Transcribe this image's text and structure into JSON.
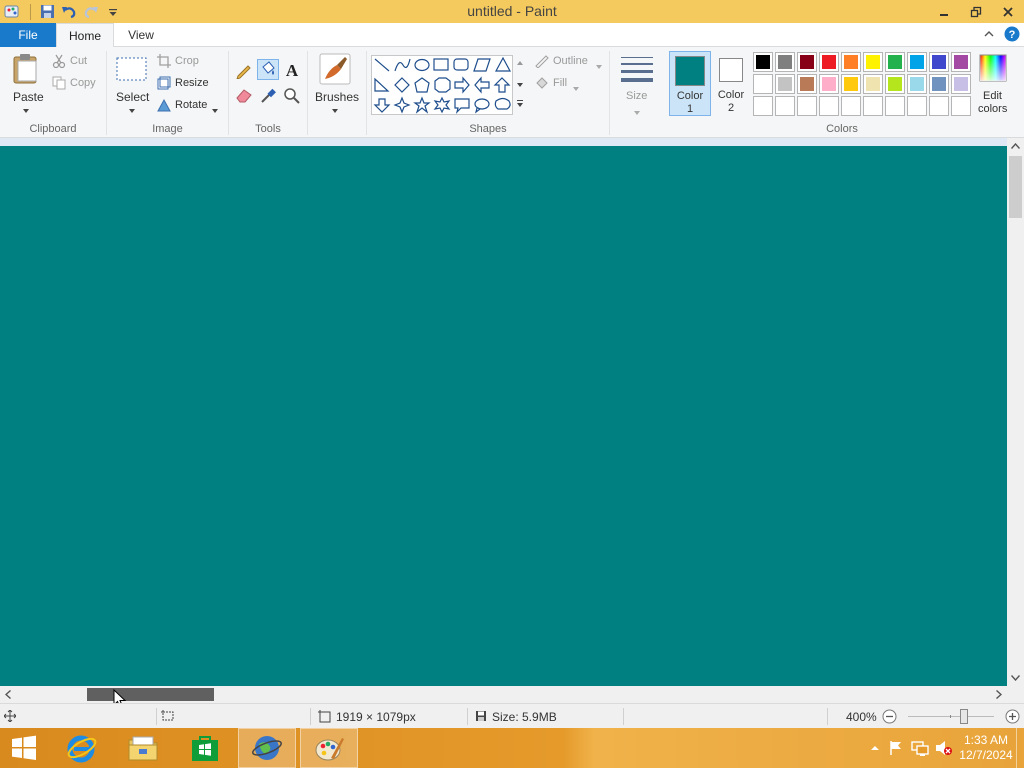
{
  "window": {
    "title": "untitled - Paint"
  },
  "tabs": {
    "file": "File",
    "home": "Home",
    "view": "View"
  },
  "ribbon": {
    "clipboard": {
      "paste": "Paste",
      "cut": "Cut",
      "copy": "Copy",
      "label": "Clipboard"
    },
    "image": {
      "select": "Select",
      "crop": "Crop",
      "resize": "Resize",
      "rotate": "Rotate",
      "label": "Image"
    },
    "tools": {
      "label": "Tools"
    },
    "brushes": {
      "label": "Brushes"
    },
    "shapes": {
      "outline": "Outline",
      "fill": "Fill",
      "label": "Shapes"
    },
    "size": {
      "label": "Size"
    },
    "colors": {
      "color1_label": "Color",
      "color1_num": "1",
      "color2_label": "Color",
      "color2_num": "2",
      "edit1": "Edit",
      "edit2": "colors",
      "label": "Colors",
      "color1": "#008080",
      "color2": "#ffffff",
      "palette_row1": [
        "#000000",
        "#7f7f7f",
        "#880015",
        "#ed1c24",
        "#ff7f27",
        "#fff200",
        "#22b14c",
        "#00a2e8",
        "#3f48cc",
        "#a349a4"
      ],
      "palette_row2": [
        "#ffffff",
        "#c3c3c3",
        "#b97a57",
        "#ffaec9",
        "#ffc90e",
        "#efe4b0",
        "#b5e61d",
        "#99d9ea",
        "#7092be",
        "#c8bfe7"
      ]
    }
  },
  "canvas": {
    "color": "#008080"
  },
  "status": {
    "dimensions": "1919 × 1079px",
    "size": "Size: 5.9MB",
    "zoom": "400%"
  },
  "taskbar": {
    "time": "1:33 AM",
    "date": "12/7/2024"
  }
}
